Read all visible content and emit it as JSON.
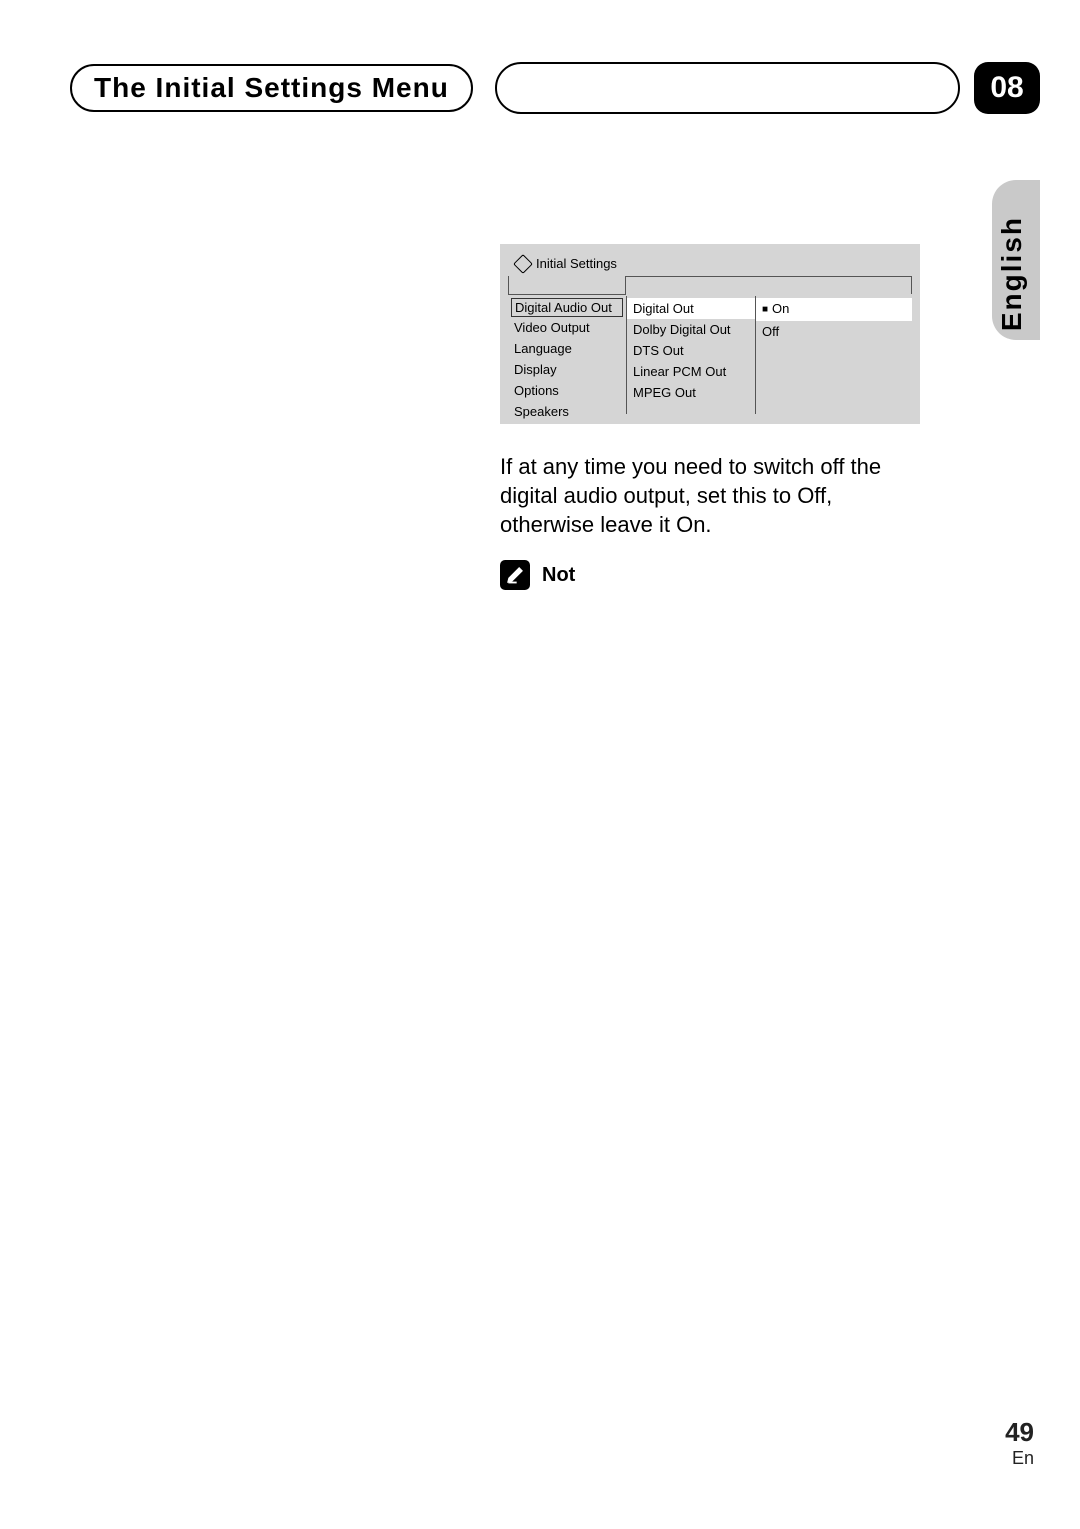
{
  "header": {
    "title": "The Initial Settings Menu",
    "chapter": "08"
  },
  "lang_tab": "English",
  "osd": {
    "title": "Initial Settings",
    "col1": [
      "Digital Audio Out",
      "Video Output",
      "Language",
      "Display",
      "Options",
      "Speakers"
    ],
    "col2": [
      "Digital Out",
      "Dolby Digital Out",
      "DTS Out",
      "Linear PCM Out",
      "MPEG Out"
    ],
    "col3": [
      "On",
      "Off"
    ]
  },
  "body_text": "If at any time you need to switch off the digital audio output, set this to Off, otherwise leave it On.",
  "note_label": "Not",
  "footer": {
    "page": "49",
    "lang": "En"
  }
}
